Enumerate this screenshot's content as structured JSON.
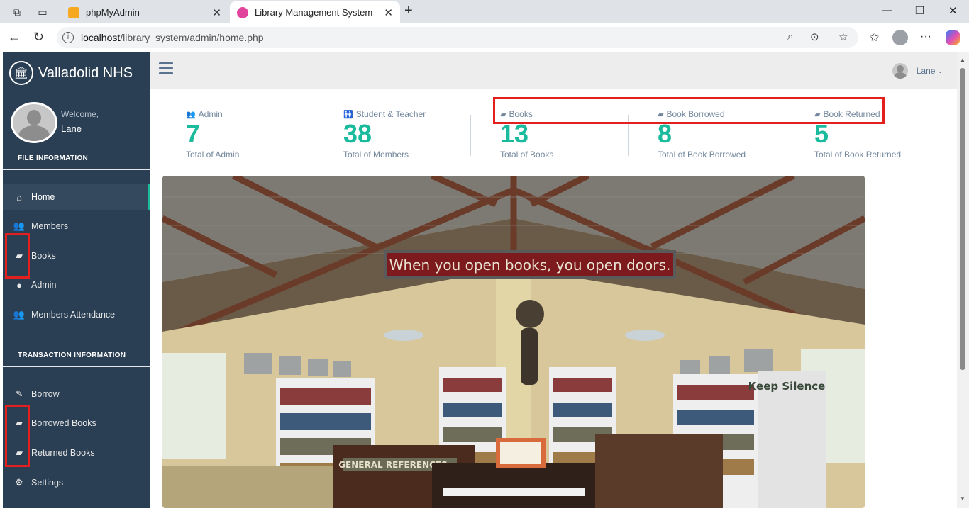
{
  "browser": {
    "tabs": [
      {
        "title": "phpMyAdmin",
        "active": false
      },
      {
        "title": "Library Management System",
        "active": true
      }
    ],
    "url_host": "localhost",
    "url_path": "/library_system/admin/home.php"
  },
  "sidebar": {
    "brand": "Valladolid NHS",
    "welcome": "Welcome,",
    "username": "Lane",
    "file_section_title": "FILE INFORMATION",
    "file_items": [
      {
        "label": "Home",
        "icon": "home-icon",
        "active": true
      },
      {
        "label": "Members",
        "icon": "users-icon"
      },
      {
        "label": "Books",
        "icon": "book-icon"
      },
      {
        "label": "Admin",
        "icon": "user-icon"
      },
      {
        "label": "Members Attendance",
        "icon": "users-icon"
      }
    ],
    "transaction_section_title": "TRANSACTION INFORMATION",
    "transaction_items": [
      {
        "label": "Borrow",
        "icon": "edit-icon"
      },
      {
        "label": "Borrowed Books",
        "icon": "book-icon"
      },
      {
        "label": "Returned Books",
        "icon": "book-icon"
      },
      {
        "label": "Settings",
        "icon": "gear-icon"
      }
    ]
  },
  "topnav": {
    "user": "Lane"
  },
  "stats": [
    {
      "label": "Admin",
      "value": "7",
      "sub": "Total of Admin"
    },
    {
      "label": "Student & Teacher",
      "value": "38",
      "sub": "Total of Members"
    },
    {
      "label": "Books",
      "value": "13",
      "sub": "Total of Books"
    },
    {
      "label": "Book Borrowed",
      "value": "8",
      "sub": "Total of Book Borrowed"
    },
    {
      "label": "Book Returned",
      "value": "5",
      "sub": "Total of Book Returned"
    }
  ],
  "image": {
    "banner_text": "When you open books, you open doors.",
    "sign_text": "Keep Silence",
    "shelf_text": "GENERAL REFERENCES"
  },
  "colors": {
    "sidebar": "#2a3f54",
    "accent": "#1abb9c",
    "highlight": "#e3201e"
  }
}
